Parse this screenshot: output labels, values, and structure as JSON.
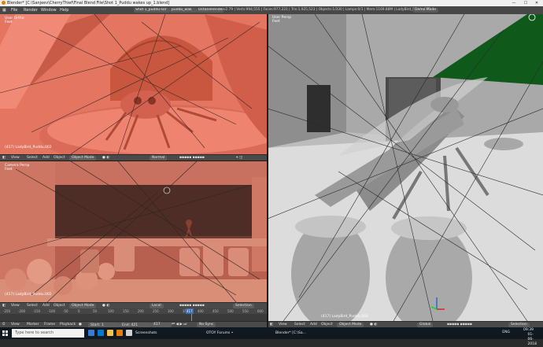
{
  "window": {
    "title": "Blender* [C:\\Sanjeev\\CherryThief\\Final Blend File\\Shot 1_Puddu wakes up_1.blend]",
    "minimize": "—",
    "maximize": "☐",
    "close": "✕"
  },
  "infobar": {
    "menus": [
      "File",
      "Render",
      "Window",
      "Help"
    ],
    "screen_layout": "Shot 1_puddu-sor",
    "scene": "puddu_wak",
    "render_engine": "OctaneRender",
    "stats": "v2.79 | Verts:994,555 | Faces:977,221 | Tris:1,925,523 | Objects:1/330 | Lamps:0/1 | Mem:1169.88M | LadyBird_Puddu.002",
    "demo_mode": "Demo Mode"
  },
  "viewports": {
    "top_left": {
      "view": "User Ortho",
      "sub": "Feet",
      "object": "(417) LadyBird_Puddu.002"
    },
    "bottom_left": {
      "view": "Camera Persp",
      "sub": "Feet",
      "object": "(417) LadyBird_Puddu.002"
    },
    "right": {
      "view": "User Persp",
      "sub": "Feet",
      "object": "(417) LadyBird_Puddu.002"
    }
  },
  "headers": {
    "menus": [
      "View",
      "Select",
      "Add",
      "Object"
    ],
    "mode": "Object Mode",
    "shading": "Normal",
    "pivot": "Local",
    "global": "Global",
    "selection": "Selection"
  },
  "timeline": {
    "ticks": [
      "-250",
      "-200",
      "-150",
      "-100",
      "-50",
      "0",
      "50",
      "100",
      "150",
      "200",
      "250",
      "300",
      "350",
      "400",
      "450",
      "500",
      "550",
      "600"
    ],
    "menus": [
      "View",
      "Marker",
      "Frame",
      "Playback"
    ],
    "start_label": "Start:",
    "start_value": "1",
    "end_label": "End:",
    "end_value": "421",
    "current_frame": "417",
    "sync": "No Sync"
  },
  "taskbar": {
    "search_placeholder": "Type here to search",
    "items": [
      "Screenshots",
      "OTOY Forums •",
      "Blender* [C:\\Sa..."
    ],
    "time": "09:39",
    "date": "01-06-2018",
    "lang": "ENG"
  },
  "colors": {
    "accent": "#e87d0d",
    "viewport_orange": "#e8735f",
    "viewport_gray": "#bdbdbd",
    "header": "#4a4a4a"
  }
}
